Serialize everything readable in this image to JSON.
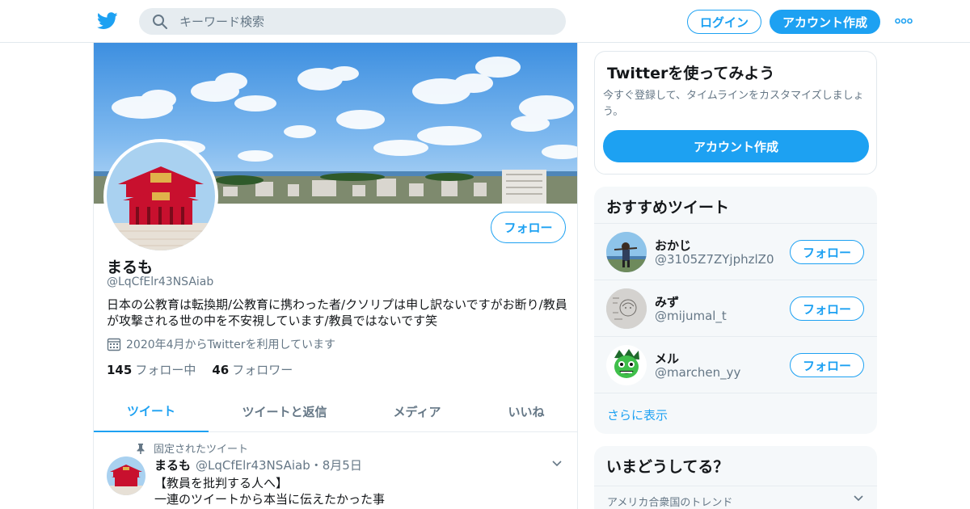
{
  "header": {
    "search_placeholder": "キーワード検索",
    "login_label": "ログイン",
    "signup_label": "アカウント作成"
  },
  "profile": {
    "name": "まるも",
    "handle": "@LqCfElr43NSAiab",
    "bio": "日本の公教育は転換期/公教育に携わった者/クソリプは申し訳ないですがお断り/教員が攻撃される世の中を不安視しています/教員ではないです笑",
    "joined": "2020年4月からTwitterを利用しています",
    "follow_label": "フォロー",
    "following_count": "145",
    "following_label": "フォロー中",
    "followers_count": "46",
    "followers_label": "フォロワー"
  },
  "tabs": [
    {
      "label": "ツイート",
      "active": true
    },
    {
      "label": "ツイートと返信",
      "active": false
    },
    {
      "label": "メディア",
      "active": false
    },
    {
      "label": "いいね",
      "active": false
    }
  ],
  "pinned_tweet": {
    "pinned_label": "固定されたツイート",
    "name": "まるも",
    "handle": "@LqCfElr43NSAiab",
    "separator": "・",
    "date": "8月5日",
    "line1": "【教員を批判する人へ】",
    "line2": "一連のツイートから本当に伝えたかった事"
  },
  "signup_card": {
    "title": "Twitterを使ってみよう",
    "subtitle": "今すぐ登録して、タイムラインをカスタマイズしましょう。",
    "button_label": "アカウント作成"
  },
  "recommended": {
    "title": "おすすめツイート",
    "follow_label": "フォロー",
    "users": [
      {
        "name": "おかじ",
        "handle": "@3105Z7ZYjphzlZ0"
      },
      {
        "name": "みず",
        "handle": "@mijumal_t"
      },
      {
        "name": "メル",
        "handle": "@marchen_yy"
      }
    ],
    "show_more": "さらに表示"
  },
  "trends": {
    "title": "いまどうしてる？",
    "location": "アメリカ合衆国のトレンド"
  },
  "colors": {
    "accent": "#1da1f2",
    "secondary_text": "#657786",
    "panel_bg": "#f5f8fa"
  }
}
